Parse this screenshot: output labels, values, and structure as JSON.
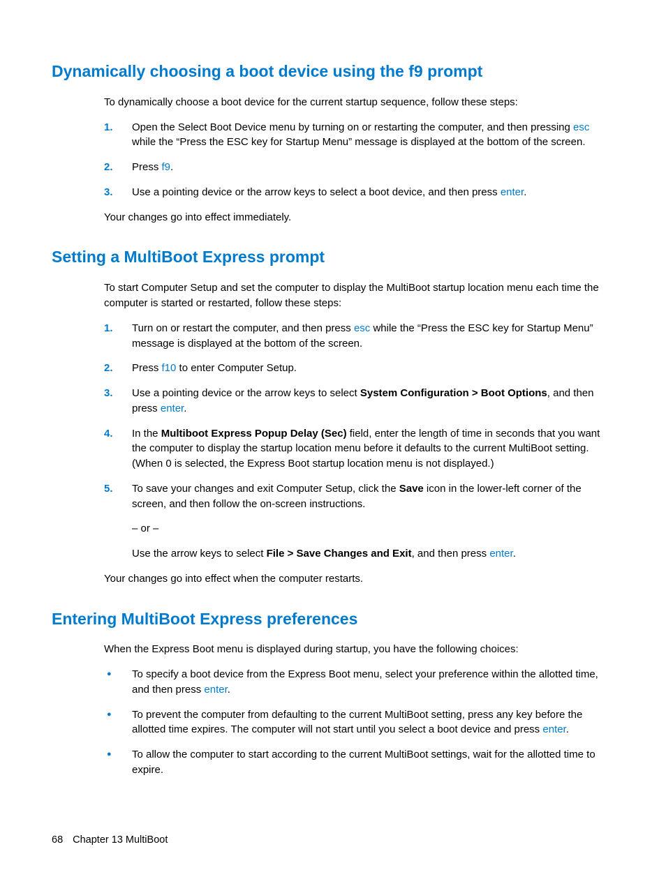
{
  "section1": {
    "heading": "Dynamically choosing a boot device using the f9 prompt",
    "intro": "To dynamically choose a boot device for the current startup sequence, follow these steps:",
    "item1_pre": "Open the Select Boot Device menu by turning on or restarting the computer, and then pressing ",
    "item1_key": "esc",
    "item1_post": " while the “Press the ESC key for Startup Menu” message is displayed at the bottom of the screen.",
    "item2_pre": "Press ",
    "item2_key": "f9",
    "item2_post": ".",
    "item3_pre": "Use a pointing device or the arrow keys to select a boot device, and then press ",
    "item3_key": "enter",
    "item3_post": ".",
    "outro": "Your changes go into effect immediately."
  },
  "section2": {
    "heading": "Setting a MultiBoot Express prompt",
    "intro": "To start Computer Setup and set the computer to display the MultiBoot startup location menu each time the computer is started or restarted, follow these steps:",
    "item1_pre": "Turn on or restart the computer, and then press ",
    "item1_key": "esc",
    "item1_post": " while the “Press the ESC key for Startup Menu” message is displayed at the bottom of the screen.",
    "item2_pre": "Press ",
    "item2_key": "f10",
    "item2_post": " to enter Computer Setup.",
    "item3_pre": "Use a pointing device or the arrow keys to select ",
    "item3_bold": "System Configuration > Boot Options",
    "item3_mid": ", and then press ",
    "item3_key": "enter",
    "item3_post": ".",
    "item4_pre": "In the ",
    "item4_bold": "Multiboot Express Popup Delay (Sec)",
    "item4_post": " field, enter the length of time in seconds that you want the computer to display the startup location menu before it defaults to the current MultiBoot setting. (When 0 is selected, the Express Boot startup location menu is not displayed.)",
    "item5_pre": "To save your changes and exit Computer Setup, click the ",
    "item5_bold": "Save",
    "item5_post": " icon in the lower-left corner of the screen, and then follow the on-screen instructions.",
    "item5_or": "– or –",
    "item5b_pre": "Use the arrow keys to select ",
    "item5b_bold": "File > Save Changes and Exit",
    "item5b_mid": ", and then press ",
    "item5b_key": "enter",
    "item5b_post": ".",
    "outro": "Your changes go into effect when the computer restarts."
  },
  "section3": {
    "heading": "Entering MultiBoot Express preferences",
    "intro": "When the Express Boot menu is displayed during startup, you have the following choices:",
    "b1_pre": "To specify a boot device from the Express Boot menu, select your preference within the allotted time, and then press ",
    "b1_key": "enter",
    "b1_post": ".",
    "b2_pre": "To prevent the computer from defaulting to the current MultiBoot setting, press any key before the allotted time expires. The computer will not start until you select a boot device and press ",
    "b2_key": "enter",
    "b2_post": ".",
    "b3": "To allow the computer to start according to the current MultiBoot settings, wait for the allotted time to expire."
  },
  "footer": {
    "page_no": "68",
    "chapter": "Chapter 13   MultiBoot"
  },
  "nums": {
    "n1": "1.",
    "n2": "2.",
    "n3": "3.",
    "n4": "4.",
    "n5": "5."
  }
}
